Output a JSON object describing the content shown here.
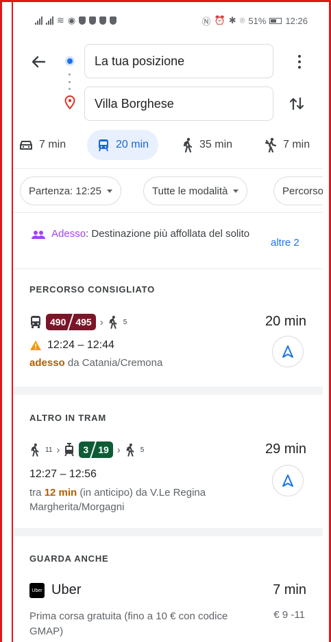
{
  "status_bar": {
    "battery": "51%",
    "time": "12:26"
  },
  "search": {
    "origin": "La tua posizione",
    "destination": "Villa Borghese"
  },
  "modes": [
    {
      "name": "car",
      "icon": "car-icon",
      "label": "7 min"
    },
    {
      "name": "transit",
      "icon": "transit-icon",
      "label": "20 min",
      "active": true
    },
    {
      "name": "walk",
      "icon": "walk-icon",
      "label": "35 min"
    },
    {
      "name": "ride",
      "icon": "ride-icon",
      "label": "7 min"
    }
  ],
  "filters": {
    "departure": "Partenza: 12:25",
    "modes": "Tutte le modalità",
    "route": "Percorso"
  },
  "crowd_alert": {
    "highlight": "Adesso",
    "text": ": Destinazione più affollata del solito",
    "link": "altre 2",
    "accent": "#a142f4"
  },
  "recommended": {
    "title": "PERCORSO CONSIGLIATO",
    "lines": [
      "490",
      "495"
    ],
    "line_color": "#7b1528",
    "walk_minutes": "5",
    "duration": "20 min",
    "times": "12:24 – 12:44",
    "now_label": "adesso",
    "from": " da Catania/Cremona",
    "warning_color": "#f29900"
  },
  "tram": {
    "title": "ALTRO IN TRAM",
    "walk_before": "11",
    "lines": [
      "3",
      "19"
    ],
    "line_color": "#0d5c36",
    "walk_after": "5",
    "duration": "29 min",
    "times": "12:27 – 12:56",
    "prefix": "tra ",
    "wait": "12 min",
    "suffix": " (in anticipo) da V.Le Regina Margherita/Morgagni"
  },
  "see_also": {
    "title": "GUARDA ANCHE",
    "logo_text": "Uber",
    "name": "Uber",
    "duration": "7 min",
    "description": "Prima corsa gratuita (fino a 10 € con codice GMAP)",
    "price": "€ 9 -11"
  }
}
